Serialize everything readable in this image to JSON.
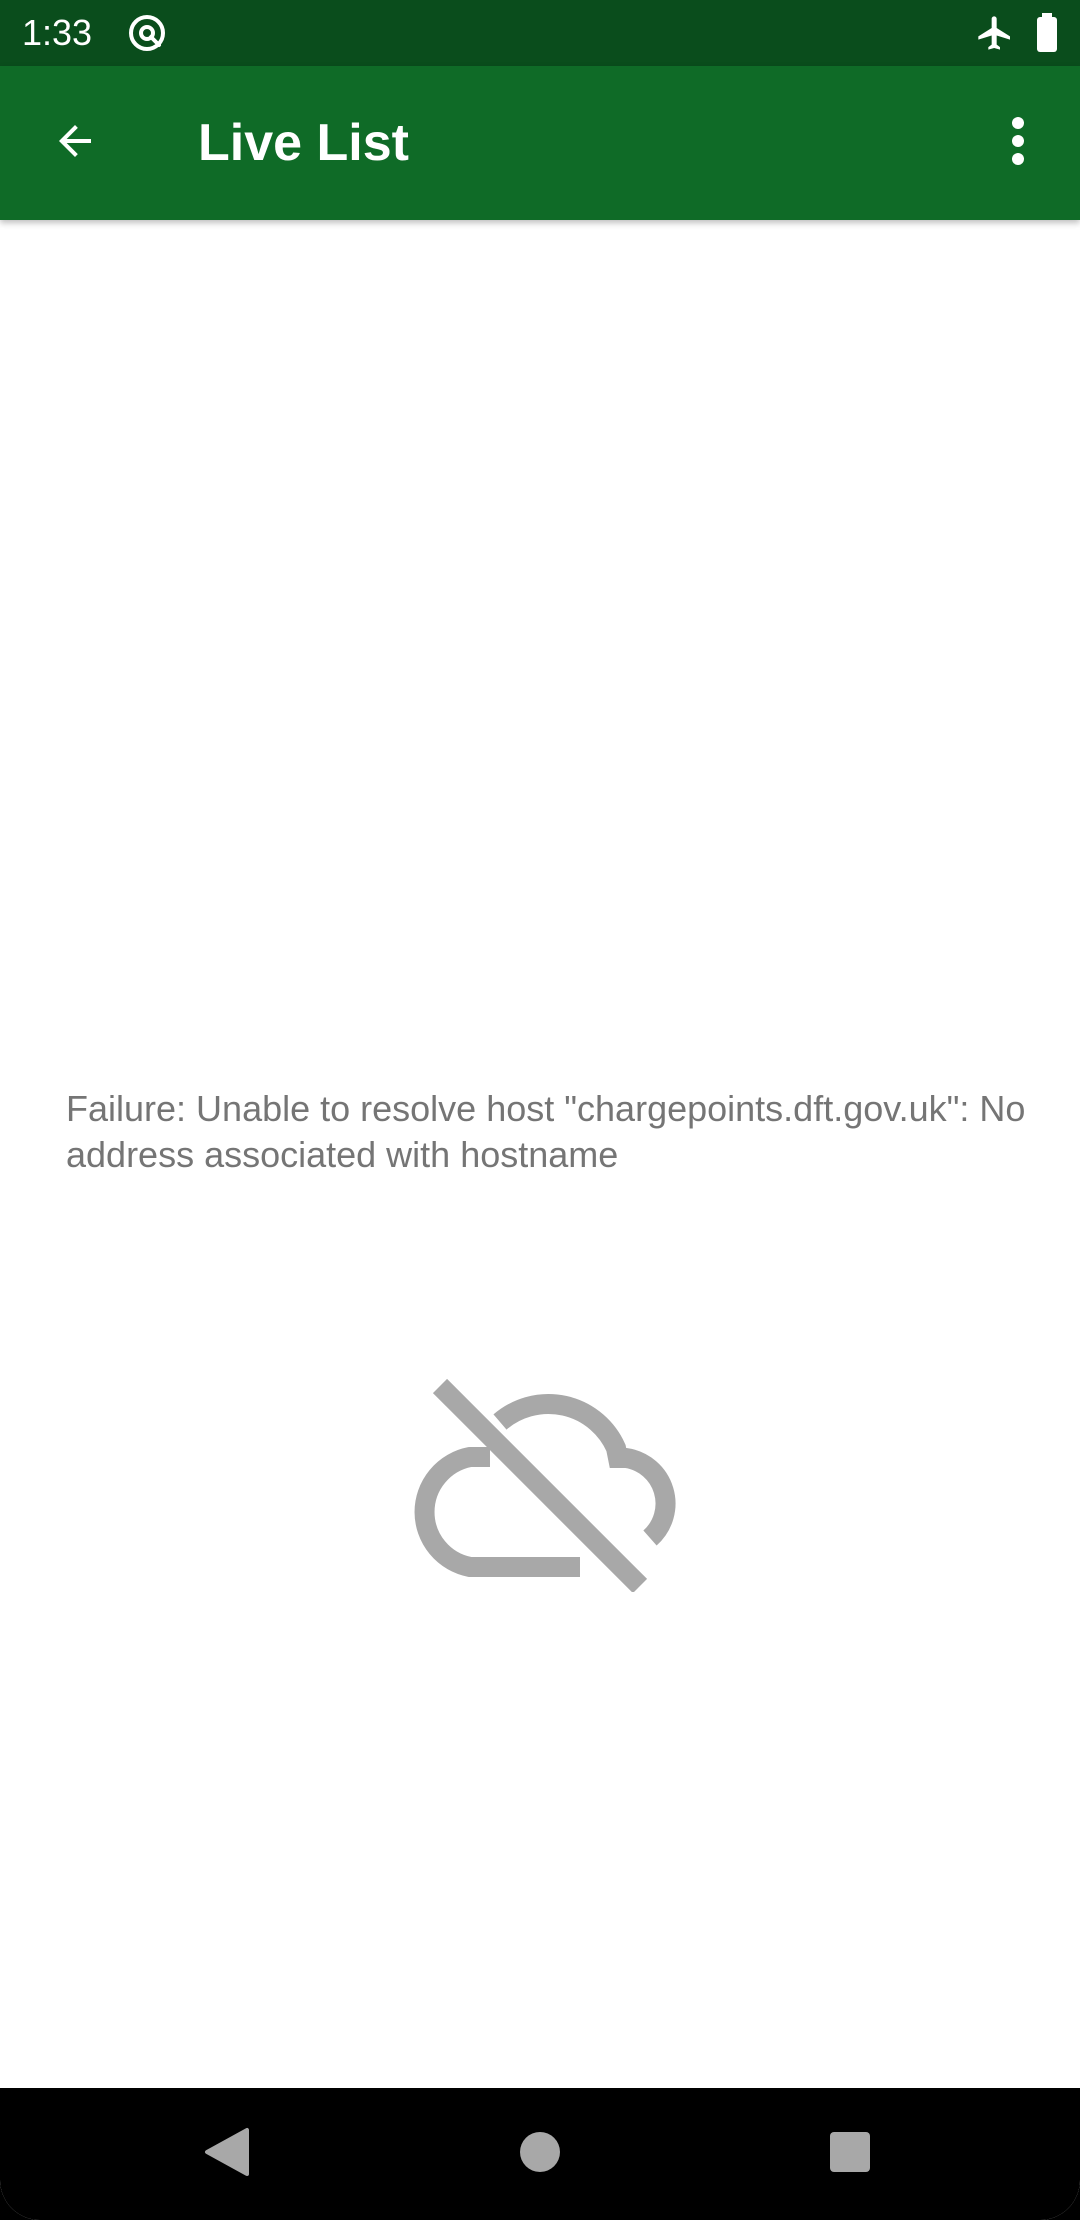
{
  "status_bar": {
    "time": "1:33",
    "icons": [
      "at-sign-notification-icon",
      "airplane-mode-icon",
      "battery-full-icon"
    ]
  },
  "app_bar": {
    "title": "Live List",
    "back_icon": "arrow-back-icon",
    "menu_icon": "more-vert-icon",
    "background_color": "#0f6b27",
    "status_color": "#0a4d1c"
  },
  "content": {
    "error_message": "Failure: Unable to resolve host \"chargepoints.dft.gov.uk\": No address associated with hostname",
    "illustration_icon": "cloud-off-icon",
    "illustration_color": "#a8a8a8"
  },
  "nav_bar": {
    "buttons": [
      "back-triangle-icon",
      "home-circle-icon",
      "recents-square-icon"
    ]
  }
}
